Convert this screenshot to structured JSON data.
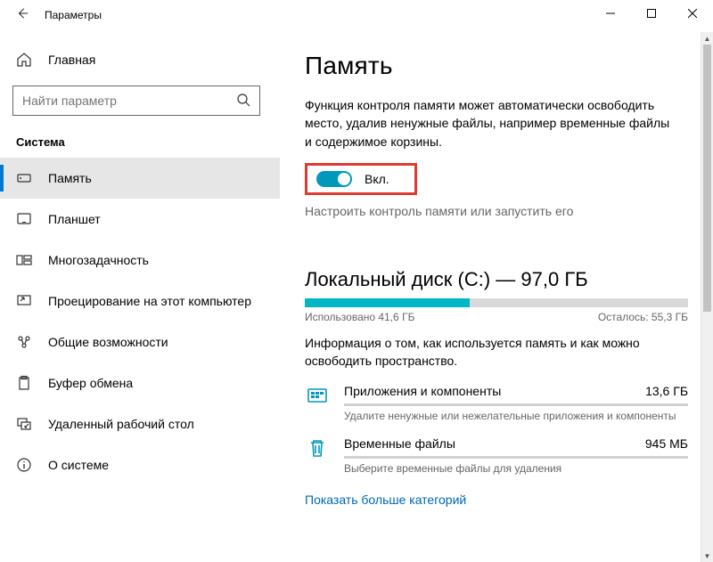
{
  "window": {
    "title": "Параметры"
  },
  "sidebar": {
    "home_label": "Главная",
    "search_placeholder": "Найти параметр",
    "section_label": "Система",
    "items": [
      {
        "label": "Память",
        "icon": "storage",
        "active": true
      },
      {
        "label": "Планшет",
        "icon": "tablet",
        "active": false
      },
      {
        "label": "Многозадачность",
        "icon": "multitask",
        "active": false
      },
      {
        "label": "Проецирование на этот компьютер",
        "icon": "project",
        "active": false
      },
      {
        "label": "Общие возможности",
        "icon": "shared",
        "active": false
      },
      {
        "label": "Буфер обмена",
        "icon": "clipboard",
        "active": false
      },
      {
        "label": "Удаленный рабочий стол",
        "icon": "remote",
        "active": false
      },
      {
        "label": "О системе",
        "icon": "about",
        "active": false
      }
    ]
  },
  "main": {
    "title": "Память",
    "storage_sense_desc": "Функция контроля памяти может автоматически освободить место, удалив ненужные файлы, например временные файлы и содержимое корзины.",
    "toggle_label": "Вкл.",
    "configure_link": "Настроить контроль памяти или запустить его",
    "disk": {
      "title": "Локальный диск (C:) — 97,0 ГБ",
      "used_pct": 43,
      "used_label": "Использовано 41,6 ГБ",
      "free_label": "Осталось: 55,3 ГБ",
      "desc": "Информация о том, как используется память и как можно освободить пространство."
    },
    "categories": [
      {
        "name": "Приложения и компоненты",
        "size": "13,6 ГБ",
        "hint": "Удалите ненужные или нежелательные приложения и компоненты",
        "icon": "apps"
      },
      {
        "name": "Временные файлы",
        "size": "945 МБ",
        "hint": "Выберите временные файлы для удаления",
        "icon": "trash"
      }
    ],
    "show_more": "Показать больше категорий"
  },
  "colors": {
    "accent": "#0078d4",
    "teal": "#00b7c3",
    "highlight": "#e03a30"
  }
}
